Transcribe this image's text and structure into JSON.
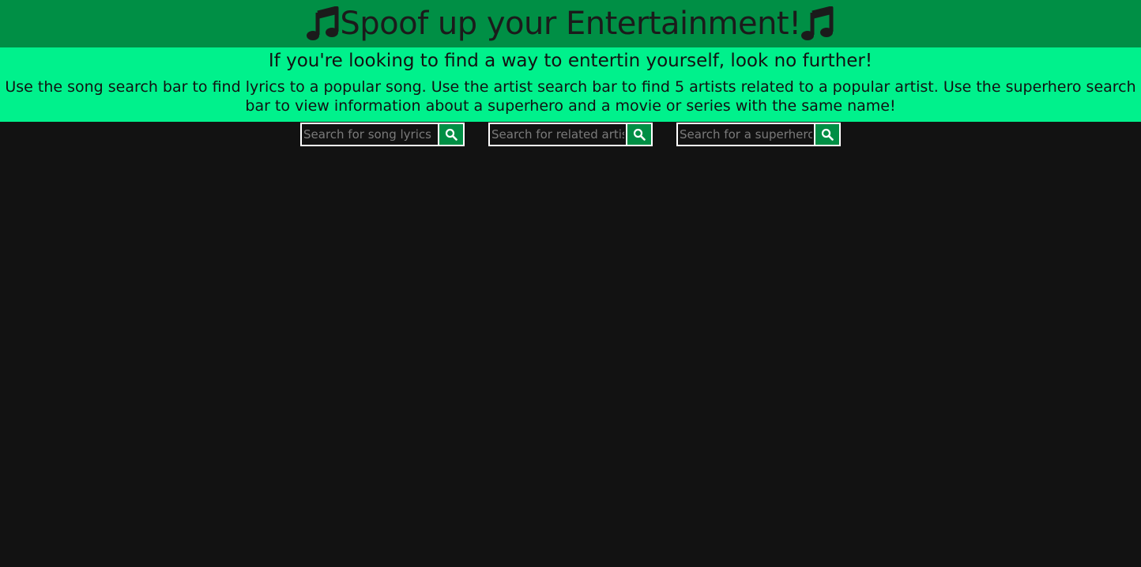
{
  "header": {
    "title": "Spoof up your Entertainment!",
    "icon": "music-note-icon",
    "background_color": "#008f45"
  },
  "intro": {
    "heading": "If you're looking to find a way to entertin yourself, look no further!",
    "description": "Use the song search bar to find lyrics to a popular song. Use the artist search bar to find 5 artists related to a popular artist. Use the superhero search bar to view information about a superhero and a movie or series with the same name!",
    "background_color": "#00f18c"
  },
  "searches": [
    {
      "placeholder": "Search for song lyrics",
      "value": "",
      "icon": "search-icon"
    },
    {
      "placeholder": "Search for related artists",
      "value": "",
      "icon": "search-icon"
    },
    {
      "placeholder": "Search for a superhero",
      "value": "",
      "icon": "search-icon"
    }
  ],
  "page_background": "#121212"
}
